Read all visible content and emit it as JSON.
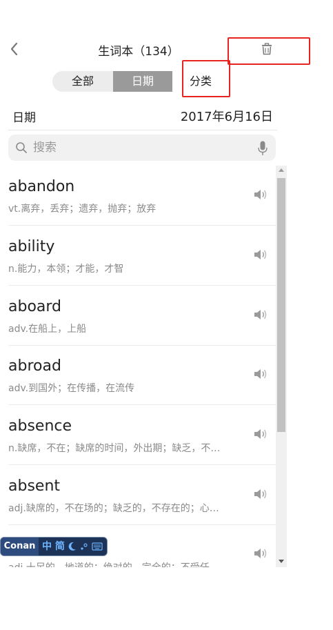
{
  "header": {
    "title": "生词本（134）",
    "back_icon": "chevron-left-icon",
    "delete_icon": "trash-icon"
  },
  "tabs": [
    {
      "label": "全部",
      "active": false
    },
    {
      "label": "日期",
      "active": true
    },
    {
      "label": "分类",
      "active": false
    }
  ],
  "date_row": {
    "label": "日期",
    "value": "2017年6月16日"
  },
  "search": {
    "placeholder": "搜索",
    "value": "",
    "search_icon": "search-icon",
    "mic_icon": "microphone-icon"
  },
  "words": [
    {
      "word": "abandon",
      "meaning": "vt.离弃，丢弃；遗弃，抛弃；放弃"
    },
    {
      "word": "ability",
      "meaning": "n.能力，本领；才能，才智"
    },
    {
      "word": "aboard",
      "meaning": "adv.在船上，上船"
    },
    {
      "word": "abroad",
      "meaning": "adv.到国外；在传播，在流传"
    },
    {
      "word": "absence",
      "meaning": "n.缺席，不在；缺席的时间，外出期；缺乏，不…"
    },
    {
      "word": "absent",
      "meaning": "adj.缺席的，不在场的；缺乏的，不存在的；心…"
    },
    {
      "word": "",
      "meaning": "adj.十足的，地道的；绝对的，完全的；不受任…"
    }
  ],
  "ime_bar": {
    "name": "Conan",
    "mode": "中 简"
  },
  "colors": {
    "highlight_box": "#e8231f",
    "active_tab": "#9a9a9a"
  }
}
